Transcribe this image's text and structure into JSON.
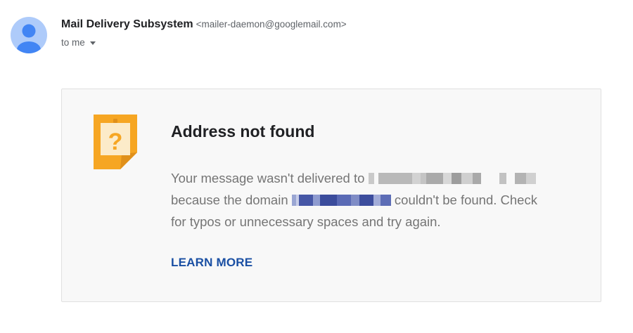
{
  "message": {
    "sender_name": "Mail Delivery Subsystem",
    "sender_email": "<mailer-daemon@googlemail.com>",
    "recipient_label": "to me",
    "avatar_icon": "person-icon"
  },
  "bounce": {
    "icon": "question-note-icon",
    "title": "Address not found",
    "line1_text": "Your message wasn't delivered to",
    "line2_pre": "because the domain",
    "line2_post": "couldn't be found. Check",
    "line3_text": "for typos or unnecessary spaces and try again.",
    "learn_more": "LEARN MORE"
  },
  "colors": {
    "avatar_bg": "#aecbfa",
    "avatar_figure": "#4285f4",
    "note_orange": "#f6a623",
    "link_blue": "#1a4fa3"
  }
}
